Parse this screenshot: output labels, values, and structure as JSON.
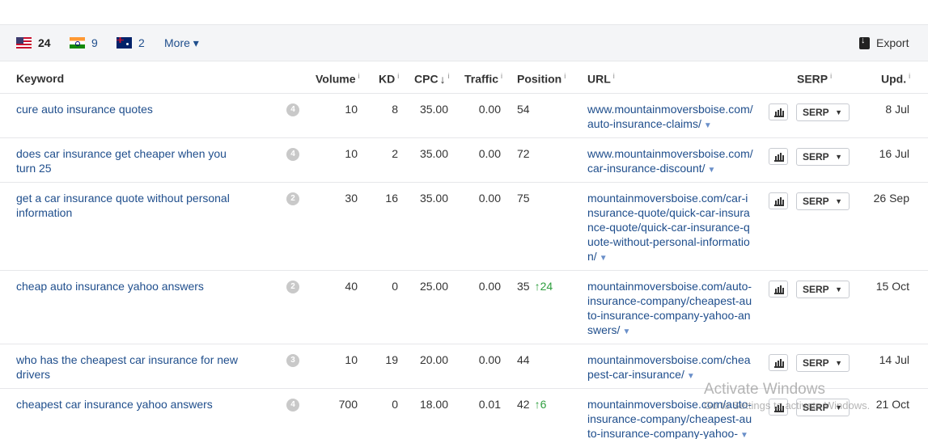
{
  "countries": [
    {
      "flag": "us-flag-icon",
      "count": "24",
      "active": true
    },
    {
      "flag": "india-flag-icon",
      "count": "9",
      "active": false
    },
    {
      "flag": "australia-flag-icon",
      "count": "2",
      "active": false
    }
  ],
  "more_label": "More",
  "more_caret": "▾",
  "export_label": "Export",
  "info_mark": "i",
  "headers": {
    "keyword": "Keyword",
    "volume": "Volume",
    "kd": "KD",
    "cpc": "CPC",
    "cpc_sort": "↓",
    "traffic": "Traffic",
    "position": "Position",
    "url": "URL",
    "serp": "SERP",
    "upd": "Upd."
  },
  "serp_button_label": "SERP",
  "serp_dropdown": "▼",
  "url_caret": "▼",
  "rows": [
    {
      "keyword": "cure auto insurance quotes",
      "badge": "4",
      "volume": "10",
      "kd": "8",
      "cpc": "35.00",
      "traffic": "0.00",
      "position": "54",
      "pos_change": "",
      "url": "www.mountainmoversboise.com/auto-insurance-claims/",
      "updated": "8 Jul"
    },
    {
      "keyword": "does car insurance get cheaper when you turn 25",
      "badge": "4",
      "volume": "10",
      "kd": "2",
      "cpc": "35.00",
      "traffic": "0.00",
      "position": "72",
      "pos_change": "",
      "url": "www.mountainmoversboise.com/car-insurance-discount/",
      "updated": "16 Jul"
    },
    {
      "keyword": "get a car insurance quote without personal information",
      "badge": "2",
      "volume": "30",
      "kd": "16",
      "cpc": "35.00",
      "traffic": "0.00",
      "position": "75",
      "pos_change": "",
      "url": "mountainmoversboise.com/car-insurance-quote/quick-car-insurance-quote/quick-car-insurance-quote-without-personal-information/",
      "updated": "26 Sep"
    },
    {
      "keyword": "cheap auto insurance yahoo answers",
      "badge": "2",
      "volume": "40",
      "kd": "0",
      "cpc": "25.00",
      "traffic": "0.00",
      "position": "35",
      "pos_change": "↑24",
      "url": "mountainmoversboise.com/auto-insurance-company/cheapest-auto-insurance-company-yahoo-answers/",
      "updated": "15 Oct"
    },
    {
      "keyword": "who has the cheapest car insurance for new drivers",
      "badge": "3",
      "volume": "10",
      "kd": "19",
      "cpc": "20.00",
      "traffic": "0.00",
      "position": "44",
      "pos_change": "",
      "url": "mountainmoversboise.com/cheapest-car-insurance/",
      "updated": "14 Jul"
    },
    {
      "keyword": "cheapest car insurance yahoo answers",
      "badge": "4",
      "volume": "700",
      "kd": "0",
      "cpc": "18.00",
      "traffic": "0.01",
      "position": "42",
      "pos_change": "↑6",
      "url": "mountainmoversboise.com/auto-insurance-company/cheapest-auto-insurance-company-yahoo-",
      "updated": "21 Oct"
    }
  ],
  "watermark": {
    "line1": "Activate Windows",
    "line2": "Go to Settings to activate Windows."
  },
  "colors": {
    "link": "#1f4e8c",
    "positive_change": "#2e9e3e",
    "bar_bg": "#f4f5f7"
  }
}
